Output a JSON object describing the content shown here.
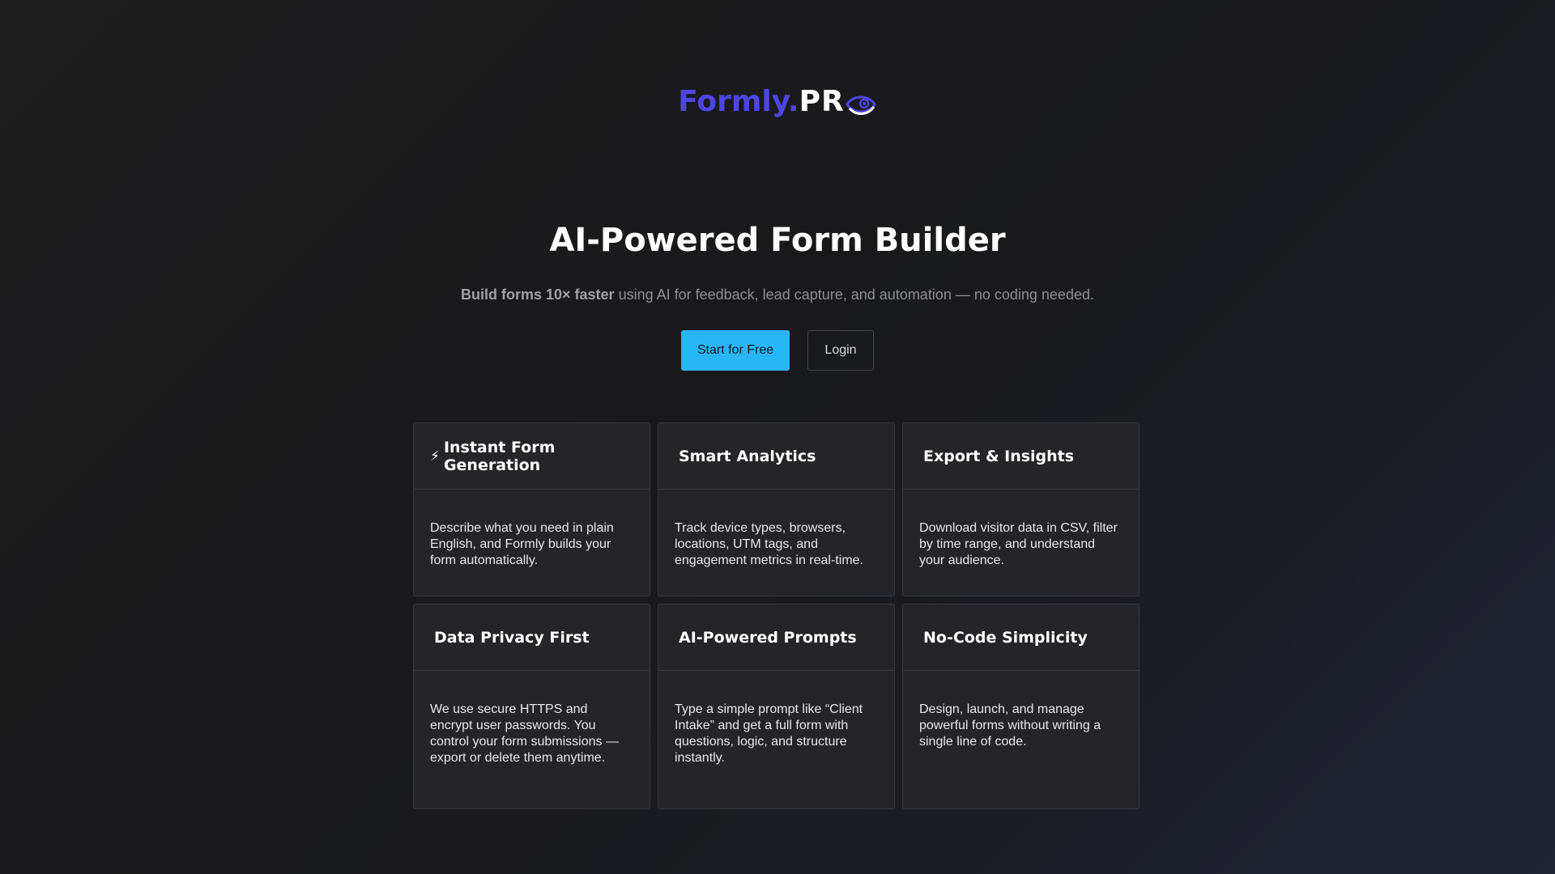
{
  "logo": {
    "part1": "Formly.",
    "part2": "PR"
  },
  "hero": {
    "title_icon": "",
    "title": "AI-Powered Form Builder",
    "subtitle_bold": "Build forms 10× faster",
    "subtitle_rest": " using AI for feedback, lead capture, and automation — no coding needed."
  },
  "cta": {
    "primary_label": "Start for Free",
    "secondary_label": "Login"
  },
  "features": [
    {
      "icon": "⚡",
      "title": "Instant Form Generation",
      "body": "Describe what you need in plain English, and Formly builds your form automatically."
    },
    {
      "icon": "",
      "title": "Smart Analytics",
      "body": "Track device types, browsers, locations, UTM tags, and engagement metrics in real-time."
    },
    {
      "icon": "",
      "title": "Export & Insights",
      "body": "Download visitor data in CSV, filter by time range, and understand your audience."
    },
    {
      "icon": "",
      "title": "Data Privacy First",
      "body": "We use secure HTTPS and encrypt user passwords. You control your form submissions — export or delete them anytime."
    },
    {
      "icon": "",
      "title": "AI-Powered Prompts",
      "body": "Type a simple prompt like “Client Intake” and get a full form with questions, logic, and structure instantly."
    },
    {
      "icon": "",
      "title": "No-Code Simplicity",
      "body": "Design, launch, and manage powerful forms without writing a single line of code."
    }
  ],
  "colors": {
    "accent": "#29b6f6",
    "brand": "#4f46e5",
    "card_bg": "#252428"
  }
}
